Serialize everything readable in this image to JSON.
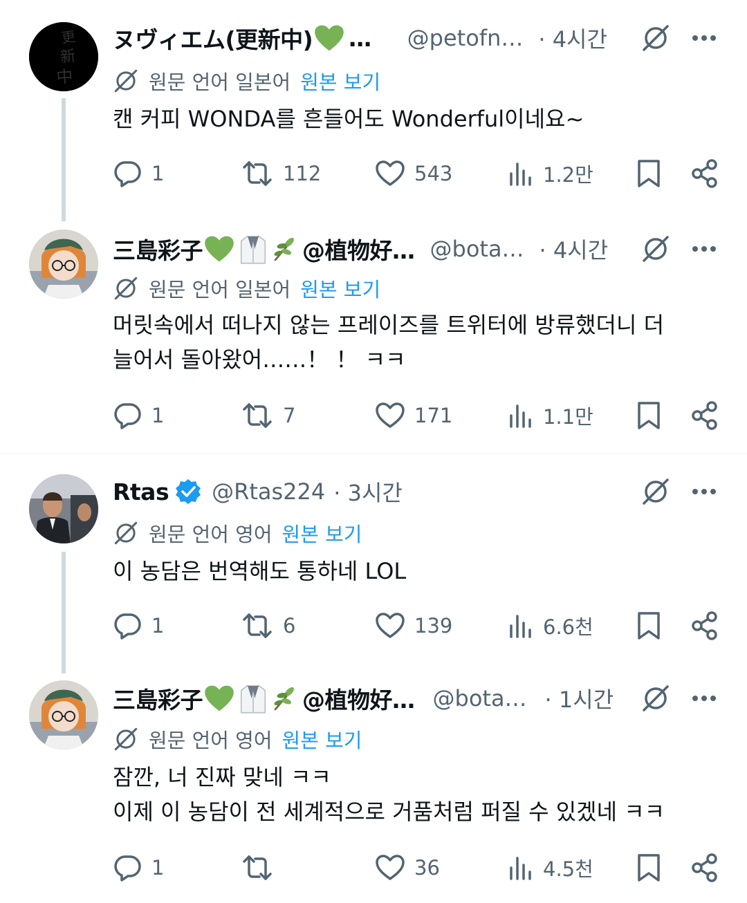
{
  "tweets": [
    {
      "name": "ヌヴィエム(更新中)",
      "name_suffix": "…",
      "handle": "@petofn…",
      "time": "· 4시간",
      "translate_text": "원문 언어 일본어",
      "translate_link": "원본 보기",
      "body_lines": [
        "캔 커피 WONDA를 흔들어도 Wonderful이네요~"
      ],
      "replies": "1",
      "retweets": "112",
      "likes": "543",
      "views": "1.2만"
    },
    {
      "name": "三島彩子",
      "name_suffix": "@植物好…",
      "handle": "@bota…",
      "time": "· 4시간",
      "translate_text": "원문 언어 일본어",
      "translate_link": "원본 보기",
      "body_lines": [
        "머릿속에서 떠나지 않는 프레이즈를 트위터에 방류했더니 더",
        "늘어서 돌아왔어……！ ！ ㅋㅋ"
      ],
      "replies": "1",
      "retweets": "7",
      "likes": "171",
      "views": "1.1만"
    },
    {
      "name": "Rtas",
      "handle": "@Rtas224",
      "time": "· 3시간",
      "translate_text": "원문 언어 영어",
      "translate_link": "원본 보기",
      "body_lines": [
        "이 농담은 번역해도 통하네 LOL"
      ],
      "replies": "1",
      "retweets": "6",
      "likes": "139",
      "views": "6.6천"
    },
    {
      "name": "三島彩子",
      "name_suffix": "@植物好…",
      "handle": "@bota…",
      "time": "· 1시간",
      "translate_text": "원문 언어 영어",
      "translate_link": "원본 보기",
      "body_lines": [
        "잠깐, 너 진짜 맞네 ㅋㅋ",
        "이제 이 농담이 전 세계적으로 거품처럼 퍼질 수 있겠네 ㅋㅋ"
      ],
      "replies": "1",
      "retweets": "",
      "likes": "36",
      "views": "4.5천"
    }
  ],
  "colors": {
    "secondary_text": "#536471",
    "link": "#1d9bf0",
    "thread_line": "#cfd9de",
    "verified": "#1d9bf0",
    "heart_emoji": "#77b255"
  },
  "icons": [
    "translate-off-icon",
    "more-icon",
    "reply-icon",
    "retweet-icon",
    "like-icon",
    "views-icon",
    "bookmark-icon",
    "share-icon"
  ]
}
